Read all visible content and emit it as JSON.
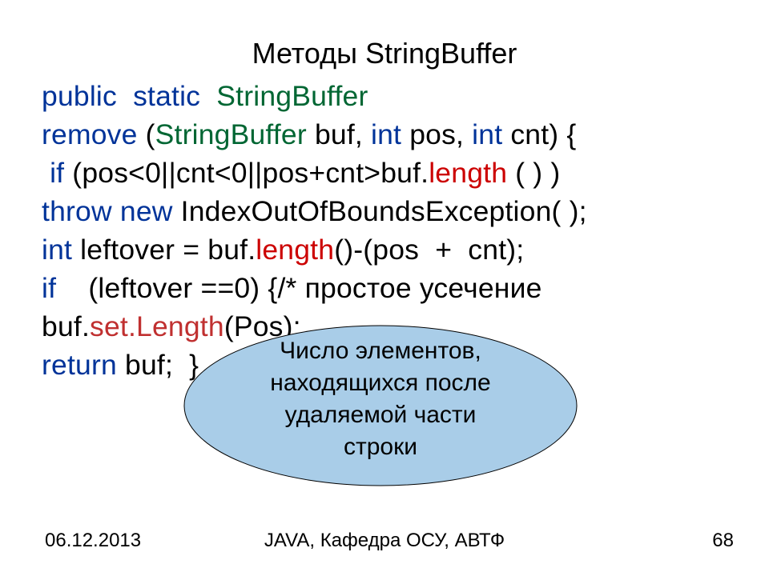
{
  "title": "Методы   StringBuffer",
  "code": {
    "l1": {
      "a": "public  static  ",
      "b": "StringBuffer"
    },
    "l2": {
      "a": "remove",
      "b": " (",
      "c": "StringBuffer",
      "d": " buf, ",
      "e": "int ",
      "f": "pos, ",
      "g": "int ",
      "h": "cnt) {"
    },
    "l3": {
      "a": " ",
      "b": "if ",
      "c": "(pos<0||cnt<0||pos+cnt>buf.",
      "d": "length",
      "e": " ( ) )"
    },
    "l4": {
      "a": "throw new",
      "b": " IndexOutOfBoundsException",
      "c": "( );"
    },
    "l5": {
      "a": "int ",
      "b": "leftover = buf.",
      "c": "length",
      "d": "()-(pos  +  cnt);"
    },
    "l6": {
      "a": "if    ",
      "b": "(leftover ==0) {/* простое усечение"
    },
    "l7": "",
    "l8": {
      "a": "buf.",
      "b": "set.Length",
      "c": "(Pos);"
    },
    "l9": {
      "a": "return",
      "b": " buf;  }"
    }
  },
  "callout": {
    "line1": "Число элементов,",
    "line2": "находящихся после",
    "line3": "удаляемой части",
    "line4": "строки"
  },
  "footer": {
    "date": "06.12.2013",
    "center": "JAVA, Кафедра ОСУ, АВТФ",
    "page": "68"
  }
}
